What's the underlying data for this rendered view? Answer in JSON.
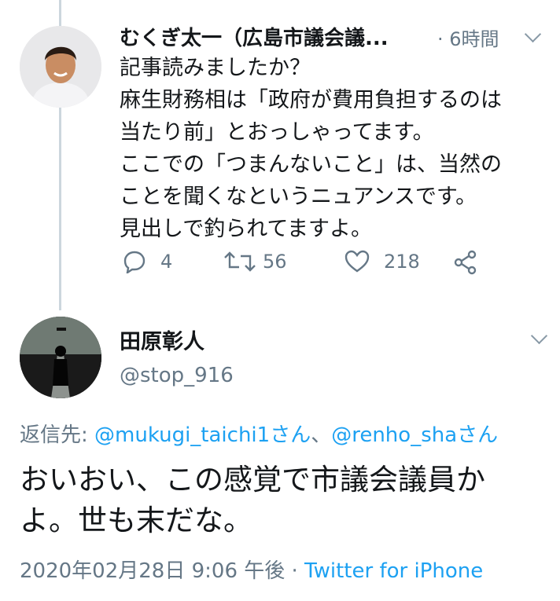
{
  "tweet1": {
    "display_name": "むくぎ太一（広島市議会議...",
    "time": "· 6時間",
    "lines": [
      "記事読みましたか？",
      "麻生財務相は「政府が費用負担するのは",
      "当たり前」とおっしゃってます。",
      "ここでの「つまんないこと」は、当然の",
      "ことを聞くなというニュアンスです。",
      "見出しで釣られてますよ。"
    ],
    "actions": {
      "reply_count": "4",
      "retweet_count": "56",
      "like_count": "218"
    }
  },
  "tweet2": {
    "display_name": "田原彰人",
    "handle": "@stop_916",
    "reply_label": "返信先: ",
    "reply_to_1": "@mukugi_taichi1さん",
    "reply_sep": "、",
    "reply_to_2": "@renho_shaさん",
    "lines": [
      "おいおい、この感覚で市議会議員か",
      "よ。世も末だな。"
    ],
    "timestamp": "2020年02月28日 9:06 午後 · ",
    "source": "Twitter for iPhone"
  },
  "colors": {
    "accent": "#1da1f2",
    "secondary_text": "#657786",
    "primary_text": "#14171a",
    "thread_line": "#ccd6dd"
  },
  "icons": [
    "reply-icon",
    "retweet-icon",
    "like-icon",
    "share-icon",
    "chevron-down-icon"
  ]
}
